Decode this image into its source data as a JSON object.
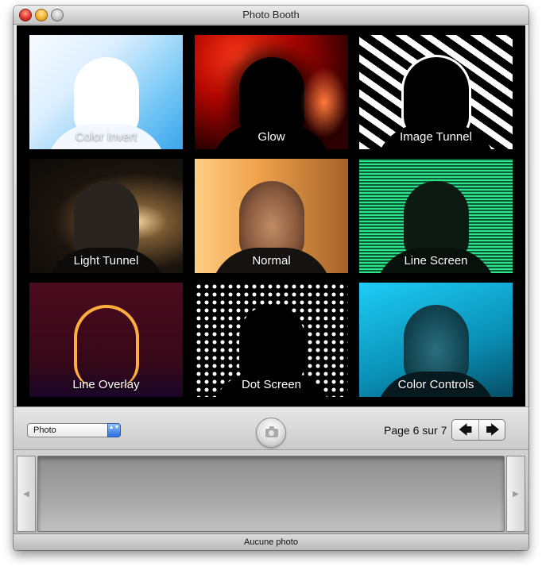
{
  "window": {
    "title": "Photo Booth"
  },
  "effects": [
    {
      "label": "Color Invert",
      "style": "t-invert"
    },
    {
      "label": "Glow",
      "style": "t-glow"
    },
    {
      "label": "Image Tunnel",
      "style": "t-tunnel"
    },
    {
      "label": "Light Tunnel",
      "style": "t-light"
    },
    {
      "label": "Normal",
      "style": "t-normal"
    },
    {
      "label": "Line Screen",
      "style": "t-linescr"
    },
    {
      "label": "Line Overlay",
      "style": "t-overlay"
    },
    {
      "label": "Dot Screen",
      "style": "t-dot"
    },
    {
      "label": "Color Controls",
      "style": "t-color"
    }
  ],
  "toolbar": {
    "mode_value": "Photo",
    "page_text": "Page 6 sur 7",
    "prev_glyph": "🡄",
    "next_glyph": "🡆",
    "select_arrows_glyph": "▲▼"
  },
  "shelf": {
    "left_glyph": "◀",
    "right_glyph": "▶"
  },
  "status": {
    "text": "Aucune photo"
  },
  "colors": {
    "accent": "#2a6ede"
  }
}
